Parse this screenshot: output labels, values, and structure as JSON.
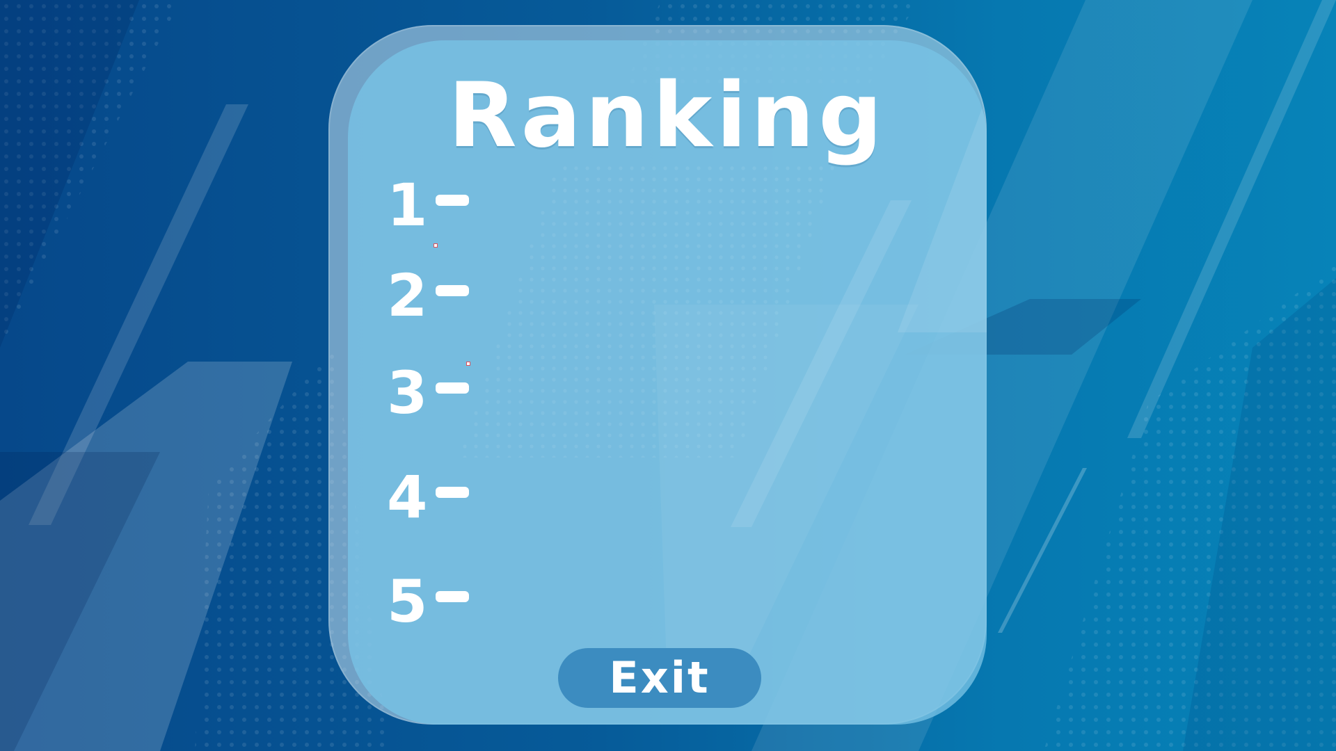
{
  "screen": {
    "title": "Ranking",
    "ranks": [
      {
        "label": "1"
      },
      {
        "label": "2"
      },
      {
        "label": "3"
      },
      {
        "label": "4"
      },
      {
        "label": "5"
      }
    ],
    "exit_label": "Exit"
  },
  "colors": {
    "background_dark": "#06488a",
    "background_light": "#0783b8",
    "panel": "#78c3e6",
    "button": "#3c8cc0",
    "text": "#ffffff"
  }
}
